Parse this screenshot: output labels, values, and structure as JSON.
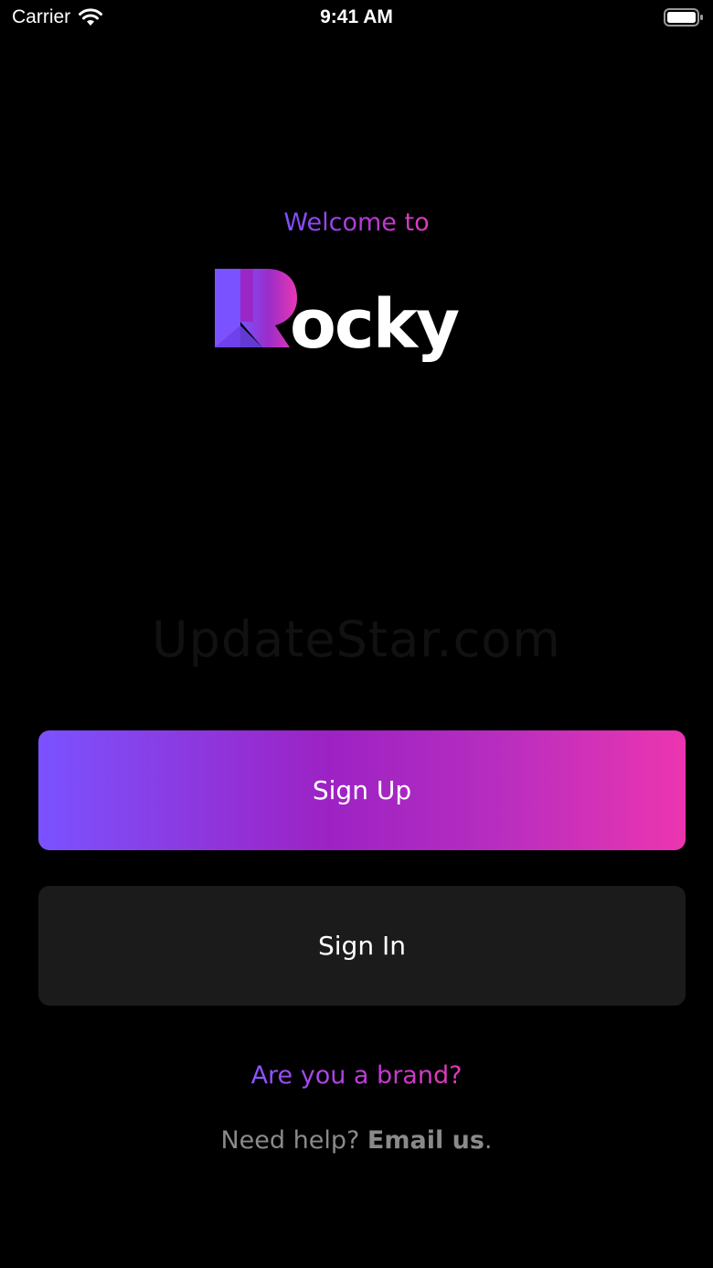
{
  "status_bar": {
    "carrier": "Carrier",
    "time": "9:41 AM"
  },
  "welcome": {
    "text": "Welcome to"
  },
  "logo": {
    "text": "Rocky",
    "icon": "rocky-logo"
  },
  "watermark": {
    "text": "UpdateStar.com"
  },
  "buttons": {
    "sign_up": "Sign Up",
    "sign_in": "Sign In"
  },
  "links": {
    "brand": "Are you a brand?",
    "help_prefix": "Need help?",
    "email": "Email us",
    "help_suffix": "."
  },
  "colors": {
    "background": "#000000",
    "accent_start": "#7a52ff",
    "accent_mid": "#9d22c4",
    "accent_end": "#ec35b0",
    "secondary_button": "#1b1b1b",
    "muted_text": "#8a8a8a"
  }
}
